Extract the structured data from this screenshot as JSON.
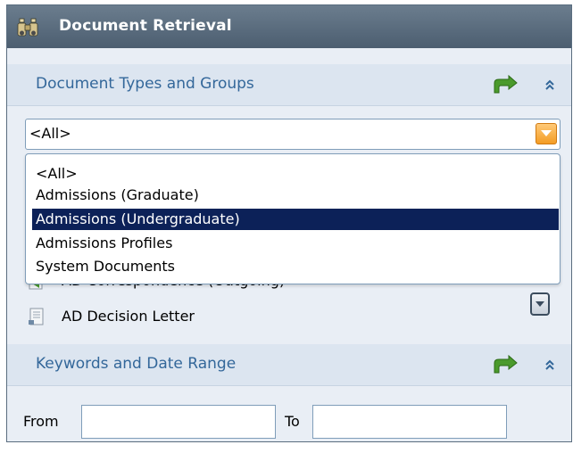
{
  "window": {
    "title": "Document Retrieval",
    "icon": "binoculars-icon"
  },
  "types_section": {
    "label": "Document Types and Groups",
    "return_icon": "return-arrow-icon",
    "collapse_icon": "double-chevron-up-icon"
  },
  "combo": {
    "value": "<All>",
    "arrow_icon": "dropdown-arrow-icon"
  },
  "dropdown": {
    "options": [
      "<All>",
      "Admissions (Graduate)",
      "Admissions (Undergraduate)",
      "Admissions Profiles",
      "System Documents"
    ],
    "selected_index": 2
  },
  "documents": {
    "items": [
      {
        "label": "AD Correspondence (Outgoing)",
        "icon": "document-icon"
      },
      {
        "label": "AD Decision Letter",
        "icon": "document-icon"
      }
    ]
  },
  "keywords_section": {
    "label": "Keywords and Date Range",
    "return_icon": "return-arrow-icon",
    "collapse_icon": "double-chevron-up-icon"
  },
  "date_range": {
    "from_label": "From",
    "to_label": "To",
    "from_value": "",
    "to_value": ""
  },
  "colors": {
    "title_bar": "#55687a",
    "section_header_bg": "#dce5f0",
    "section_header_text": "#33679a",
    "selection": "#0c2158",
    "dropdown_arrow": "#f39c24",
    "return_arrow": "#4a9a2c"
  }
}
